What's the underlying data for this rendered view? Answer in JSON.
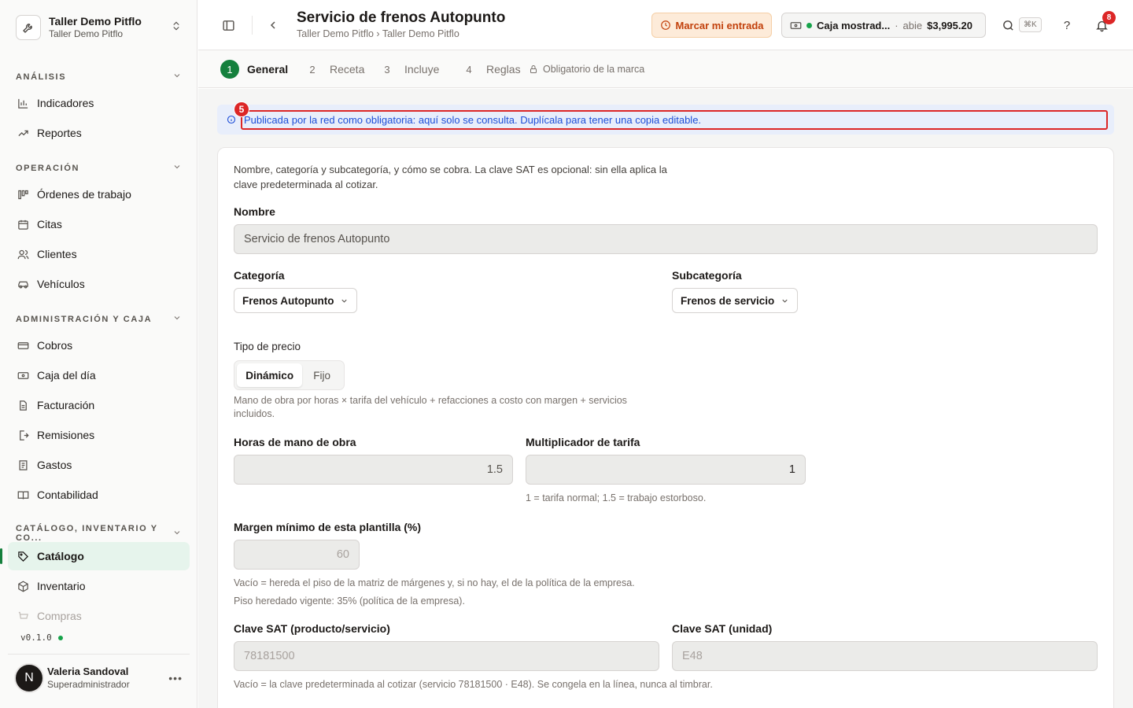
{
  "org": {
    "name": "Taller Demo Pitflo",
    "subtitle": "Taller Demo Pitflo"
  },
  "sidebar": {
    "sections": [
      {
        "title": "ANÁLISIS",
        "items": [
          {
            "label": "Indicadores",
            "icon": "bar-chart-icon"
          },
          {
            "label": "Reportes",
            "icon": "trending-up-icon"
          }
        ]
      },
      {
        "title": "OPERACIÓN",
        "items": [
          {
            "label": "Órdenes de trabajo",
            "icon": "kanban-icon"
          },
          {
            "label": "Citas",
            "icon": "calendar-icon"
          },
          {
            "label": "Clientes",
            "icon": "users-icon"
          },
          {
            "label": "Vehículos",
            "icon": "car-icon"
          }
        ]
      },
      {
        "title": "ADMINISTRACIÓN Y CAJA",
        "items": [
          {
            "label": "Cobros",
            "icon": "banknote-icon"
          },
          {
            "label": "Caja del día",
            "icon": "cash-register-icon"
          },
          {
            "label": "Facturación",
            "icon": "file-text-icon"
          },
          {
            "label": "Remisiones",
            "icon": "file-export-icon"
          },
          {
            "label": "Gastos",
            "icon": "receipt-icon"
          },
          {
            "label": "Contabilidad",
            "icon": "book-icon"
          }
        ]
      },
      {
        "title": "CATÁLOGO, INVENTARIO Y CO...",
        "items": [
          {
            "label": "Catálogo",
            "icon": "tag-icon",
            "active": true
          },
          {
            "label": "Inventario",
            "icon": "package-icon"
          },
          {
            "label": "Compras",
            "icon": "cart-icon"
          }
        ]
      }
    ],
    "version": "v0.1.0"
  },
  "user": {
    "initial": "N",
    "name": "Valeria Sandoval",
    "role": "Superadministrador"
  },
  "header": {
    "title": "Servicio de frenos Autopunto",
    "breadcrumb": "Taller Demo Pitflo › Taller Demo Pitflo",
    "checkin_label": "Marcar mi entrada",
    "cash": {
      "name": "Caja mostrad...",
      "separator": "·",
      "status": "abie",
      "amount": "$3,995.20"
    },
    "search_shortcut": "⌘K",
    "help_label": "?",
    "notification_count": "8"
  },
  "steps": [
    {
      "num": "1",
      "label": "General",
      "active": true
    },
    {
      "num": "2",
      "label": "Receta"
    },
    {
      "num": "3",
      "label": "Incluye"
    },
    {
      "num": "4",
      "label": "Reglas"
    }
  ],
  "lock_note": "Obligatorio de la marca",
  "notice": {
    "marker": "5",
    "text": "Publicada por la red como obligatoria: aquí solo se consulta. Duplícala para tener una copia editable."
  },
  "form": {
    "intro": "Nombre, categoría y subcategoría, y cómo se cobra. La clave SAT es opcional: sin ella aplica la clave predeterminada al cotizar.",
    "name_label": "Nombre",
    "name_value": "Servicio de frenos Autopunto",
    "category_label": "Categoría",
    "category_value": "Frenos Autopunto",
    "subcategory_label": "Subcategoría",
    "subcategory_value": "Frenos de servicio",
    "price_type_label": "Tipo de precio",
    "price_options": [
      "Dinámico",
      "Fijo"
    ],
    "price_help": "Mano de obra por horas × tarifa del vehículo + refacciones a costo con margen + servicios incluidos.",
    "hours_label": "Horas de mano de obra",
    "hours_value": "1.5",
    "multiplier_label": "Multiplicador de tarifa",
    "multiplier_value": "1",
    "multiplier_help": "1 = tarifa normal; 1.5 = trabajo estorboso.",
    "margin_label": "Margen mínimo de esta plantilla (%)",
    "margin_value": "60",
    "margin_help1": "Vacío = hereda el piso de la matriz de márgenes y, si no hay, el de la política de la empresa.",
    "margin_help2": "Piso heredado vigente: 35% (política de la empresa).",
    "sat_product_label": "Clave SAT (producto/servicio)",
    "sat_product_value": "78181500",
    "sat_unit_label": "Clave SAT (unidad)",
    "sat_unit_value": "E48",
    "sat_help": "Vacío = la clave predeterminada al cotizar (servicio 78181500 · E48). Se congela en la línea, nunca al timbrar."
  }
}
